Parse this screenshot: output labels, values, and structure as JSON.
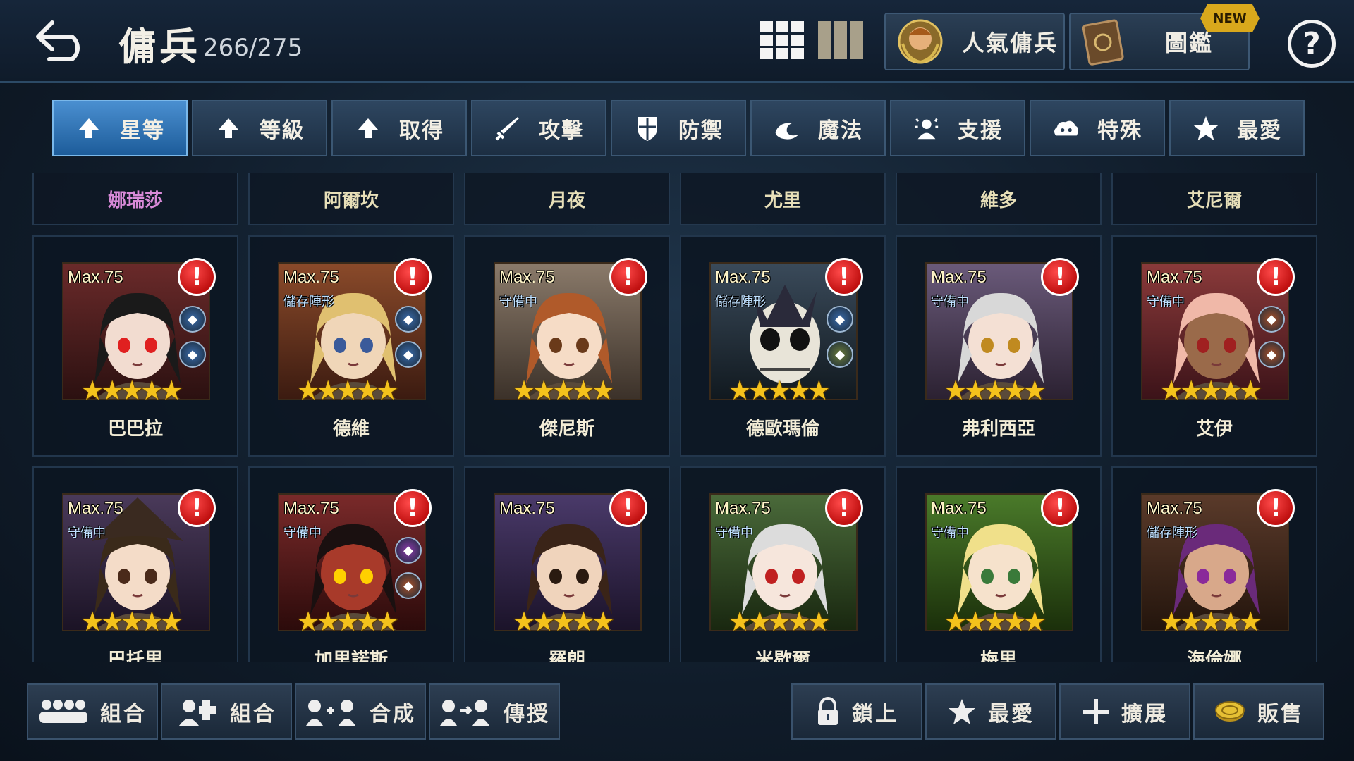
{
  "header": {
    "title": "傭兵",
    "count": "266/275",
    "popular_label": "人氣傭兵",
    "dex_label": "圖鑑",
    "new_badge": "NEW",
    "help_label": "?"
  },
  "tabs": [
    {
      "label": "星等",
      "icon": "arrow-up-icon",
      "active": true
    },
    {
      "label": "等級",
      "icon": "arrow-up-icon"
    },
    {
      "label": "取得",
      "icon": "arrow-up-icon"
    },
    {
      "label": "攻擊",
      "icon": "sword-icon"
    },
    {
      "label": "防禦",
      "icon": "shield-icon"
    },
    {
      "label": "魔法",
      "icon": "magic-icon"
    },
    {
      "label": "支援",
      "icon": "support-icon"
    },
    {
      "label": "特殊",
      "icon": "cloud-icon"
    },
    {
      "label": "最愛",
      "icon": "star-icon"
    }
  ],
  "column_headers": [
    "娜瑞莎",
    "阿爾坎",
    "月夜",
    "尤里",
    "維多",
    "艾尼爾"
  ],
  "cards": [
    {
      "name": "巴巴拉",
      "max": "Max.75",
      "tag": "",
      "stars": 5
    },
    {
      "name": "德維",
      "max": "Max.75",
      "tag": "儲存陣形",
      "stars": 5
    },
    {
      "name": "傑尼斯",
      "max": "Max.75",
      "tag": "守備中",
      "stars": 5
    },
    {
      "name": "德歐瑪倫",
      "max": "Max.75",
      "tag": "儲存陣形",
      "stars": 5
    },
    {
      "name": "弗利西亞",
      "max": "Max.75",
      "tag": "守備中",
      "stars": 5
    },
    {
      "name": "艾伊",
      "max": "Max.75",
      "tag": "守備中",
      "stars": 5
    },
    {
      "name": "巴托里",
      "max": "Max.75",
      "tag": "守備中",
      "stars": 5
    },
    {
      "name": "加里諾斯",
      "max": "Max.75",
      "tag": "守備中",
      "stars": 5
    },
    {
      "name": "羅朗",
      "max": "Max.75",
      "tag": "",
      "stars": 5
    },
    {
      "name": "米歇爾",
      "max": "Max.75",
      "tag": "守備中",
      "stars": 5
    },
    {
      "name": "梅里",
      "max": "Max.75",
      "tag": "守備中",
      "stars": 5
    },
    {
      "name": "海倫娜",
      "max": "Max.75",
      "tag": "儲存陣形",
      "stars": 5
    }
  ],
  "bottom_left": [
    {
      "label": "組合",
      "icon": "combo-icon"
    },
    {
      "label": "組合",
      "icon": "puzzle-combo-icon"
    },
    {
      "label": "合成",
      "icon": "fusion-icon"
    },
    {
      "label": "傳授",
      "icon": "transfer-icon"
    }
  ],
  "bottom_right": [
    {
      "label": "鎖上",
      "icon": "lock-icon"
    },
    {
      "label": "最愛",
      "icon": "star-icon"
    },
    {
      "label": "擴展",
      "icon": "plus-icon"
    },
    {
      "label": "販售",
      "icon": "coin-icon"
    }
  ],
  "colors": {
    "accent": "#1d5c9a",
    "star": "#f4c21c",
    "alert": "#c01010",
    "new_badge": "#d9a81c"
  }
}
